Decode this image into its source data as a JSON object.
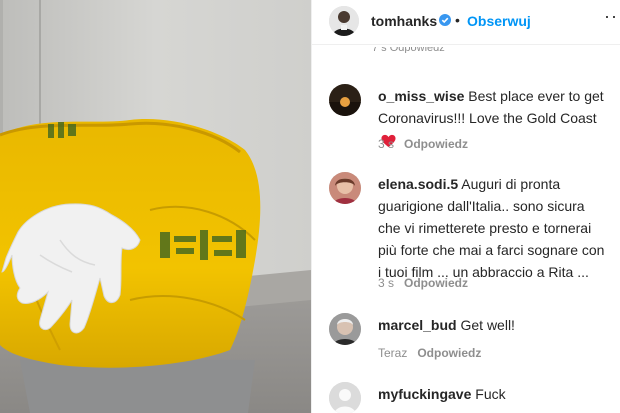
{
  "post": {
    "author": "tomhanks",
    "separator": "•",
    "follow_label": "Obserwuj",
    "more_label": "···",
    "peek_text": "7 s    Odpowiedz",
    "verified_color": "#3897f0",
    "follow_color": "#0095f6"
  },
  "comments": [
    {
      "user": "o_miss_wise",
      "text": "Best place ever to get Coronavirus!!! Love the Gold Coast",
      "time": "3 s",
      "reply_label": "Odpowiedz",
      "emoji": "heart-icon"
    },
    {
      "user": "elena.sodi.5",
      "text": "Auguri di pronta guarigione dall'Italia.. sono sicura che vi rimetterete presto e tornerai più forte che mai a farci sognare con i tuoi film ... un abbraccio a Rita ...",
      "time": "3 s",
      "reply_label": "Odpowiedz"
    },
    {
      "user": "marcel_bud",
      "text": "Get well!",
      "time": "Teraz",
      "reply_label": "Odpowiedz"
    },
    {
      "user": "myfuckingave",
      "text": "Fuck",
      "time": "",
      "reply_label": ""
    }
  ]
}
